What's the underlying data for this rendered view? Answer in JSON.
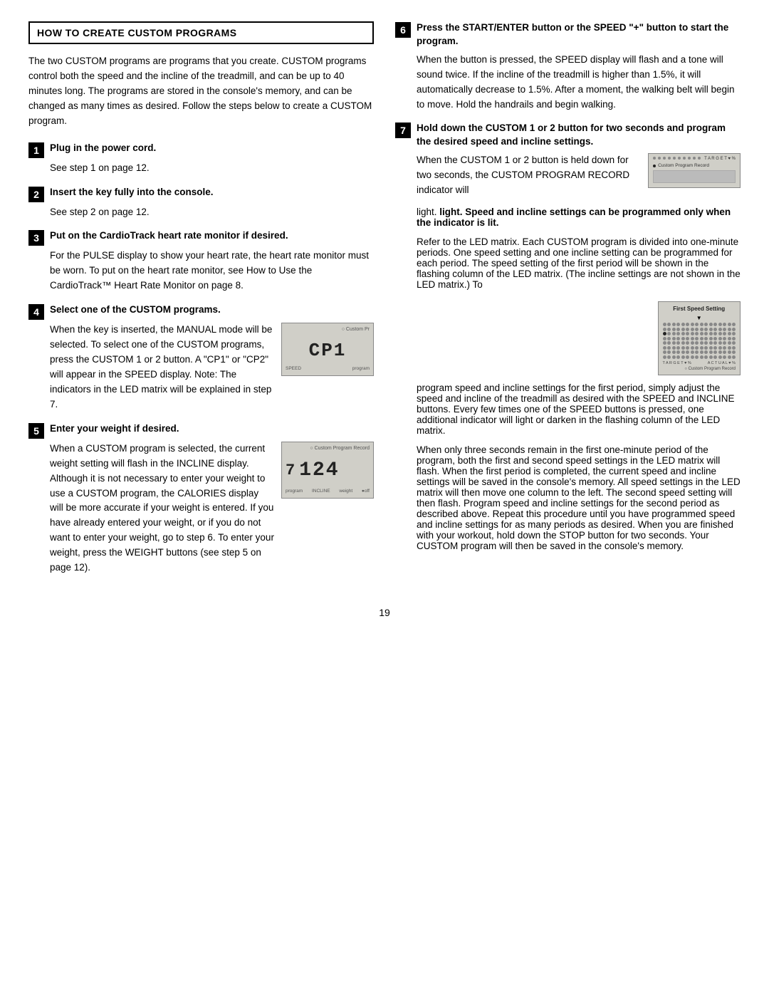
{
  "page": {
    "number": "19"
  },
  "header": {
    "title": "HOW TO CREATE CUSTOM PROGRAMS"
  },
  "intro": {
    "text": "The two CUSTOM programs are programs that you create. CUSTOM programs control both the speed and the incline of the treadmill, and can be up to 40 minutes long. The programs are stored in the console's memory, and can be changed as many times as desired. Follow the steps below to create a CUSTOM program."
  },
  "steps_left": [
    {
      "number": "1",
      "title": "Plug in the power cord.",
      "content": "See step 1 on page 12."
    },
    {
      "number": "2",
      "title": "Insert the key fully into the console.",
      "content": "See step 2 on page 12."
    },
    {
      "number": "3",
      "title": "Put on the CardioTrack heart rate monitor if desired.",
      "content": "For the PULSE display to show your heart rate, the heart rate monitor must be worn. To put on the heart rate monitor, see How to Use the CardioTrack™ Heart Rate Monitor on page 8."
    },
    {
      "number": "4",
      "title": "Select one of the CUSTOM programs.",
      "content_before": "When the key is inserted, the MANUAL mode will be selected. To select one of the CUSTOM programs, press the CUSTOM 1 or 2 button. A \"CP1\" or \"CP2\" will appear in the SPEED display. Note: The indicators in the LED matrix will be explained in step 7.",
      "display_text": "CP1"
    },
    {
      "number": "5",
      "title": "Enter your weight if desired.",
      "content_before": "When a CUSTOM program is selected, the current weight setting will flash in the INCLINE display. Although it is not necessary to enter your weight to use a CUSTOM program, the CALORIES display will be more accurate if your weight is entered. If you have already entered your weight, or if you do not want to enter your weight, go to step 6. To enter your weight, press the WEIGHT buttons (see step 5 on page 12).",
      "display_weight": "124"
    }
  ],
  "steps_right": [
    {
      "number": "6",
      "title": "Press the START/ENTER button or the SPEED \"+\" button to start the program.",
      "content": "When the button is pressed, the SPEED display will flash and a tone will sound twice. If the incline of the treadmill is higher than 1.5%, it will automatically decrease to 1.5%. After a moment, the walking belt will begin to move. Hold the handrails and begin walking."
    },
    {
      "number": "7",
      "title": "Hold down the CUSTOM 1 or 2 button for two seconds and program the desired speed and incline settings.",
      "content_part1": "When the CUSTOM 1 or 2 button is held down for two seconds, the CUSTOM PROGRAM RECORD indicator will",
      "content_part2": "light. Speed and incline settings can be programmed only when the indicator is lit.",
      "indicator_label": "Custom Program Record",
      "content_part3": "Refer to the LED matrix. Each CUSTOM program is divided into one-minute periods. One speed setting and one incline setting can be programmed for each period. The speed setting of the first period will be shown in the flashing column of the LED matrix. (The incline settings are not shown in the LED matrix.) To",
      "fss_label": "First Speed Setting",
      "content_part4": "program speed and incline settings for the first period, simply adjust the speed and incline of the treadmill as desired with the SPEED and INCLINE buttons. Every few times one of the SPEED buttons is pressed, one additional indicator will light or darken in the flashing column of the LED matrix.",
      "content_part5": "When only three seconds remain in the first one-minute period of the program, both the first and second speed settings in the LED matrix will flash. When the first period is completed, the current speed and incline settings will be saved in the console's memory. All speed settings in the LED matrix will then move one column to the left. The second speed setting will then flash. Program speed and incline settings for the second period as described above. Repeat this procedure until you have programmed speed and incline settings for as many periods as desired. When you are finished with your workout, hold down the STOP button for two seconds. Your CUSTOM program will then be saved in the console's memory."
    }
  ]
}
